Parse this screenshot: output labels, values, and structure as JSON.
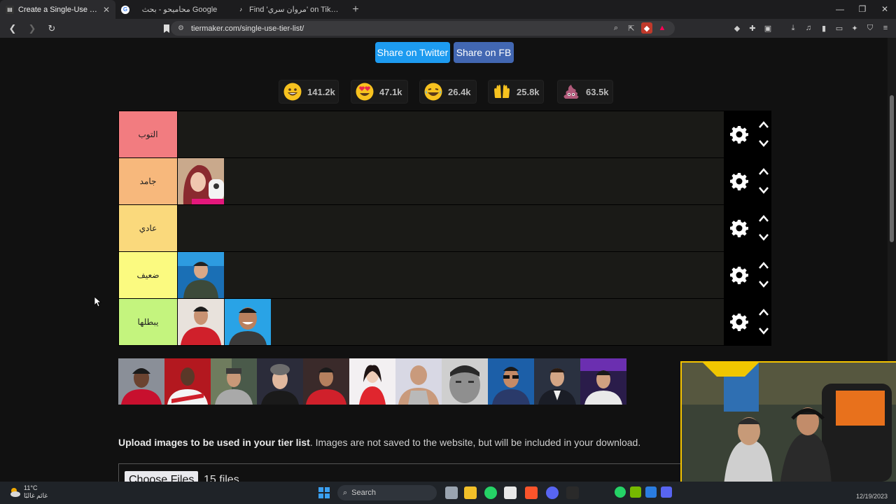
{
  "browser": {
    "tabs": [
      {
        "title": "Create a Single-Use Tier List (Pri",
        "active": true
      },
      {
        "title": "محاميحو - بحث Google",
        "active": false
      },
      {
        "title": "Find 'مروان سري' on TikTok | TikTok Se",
        "active": false
      }
    ],
    "new_tab": "+",
    "url": "tiermaker.com/single-use-tier-list/"
  },
  "share": {
    "twitter_label": "Share on Twitter",
    "fb_label": "Share on FB"
  },
  "reactions": [
    {
      "icon": "grinning-face-icon",
      "count": "141.2k",
      "color": "#f7c21f"
    },
    {
      "icon": "heart-eyes-face-icon",
      "count": "47.1k",
      "color": "#f7c21f"
    },
    {
      "icon": "laughing-tears-face-icon",
      "count": "26.4k",
      "color": "#f7c21f"
    },
    {
      "icon": "raised-hands-icon",
      "count": "25.8k",
      "color": "#f7c21f"
    },
    {
      "icon": "pile-of-poo-icon",
      "count": "63.5k",
      "color": "#b05a7a"
    }
  ],
  "tiers": [
    {
      "label": "التوب",
      "color": "#f27c80",
      "items": []
    },
    {
      "label": "جامد",
      "color": "#f7b87c",
      "items": [
        "woman-in-hijab-photo"
      ]
    },
    {
      "label": "عادي",
      "color": "#fad97c",
      "items": []
    },
    {
      "label": "ضعيف",
      "color": "#fbfa80",
      "items": [
        "man-green-shirt-photo"
      ]
    },
    {
      "label": "يبطلها",
      "color": "#c4f47e",
      "items": [
        "man-red-shirt-photo",
        "smiling-man-blue-photo"
      ]
    }
  ],
  "pool_items": [
    "footballer-liverpool-photo",
    "footballer-zamalek-photo",
    "man-cap-photo",
    "man-grey-curly-hair-photo",
    "footballer-ahly-photo",
    "woman-red-dress-photo",
    "bald-man-tanktop-photo",
    "man-close-up-photo",
    "man-sunglasses-photo",
    "man-suit-photo",
    "gamer-purple-photo"
  ],
  "upload": {
    "text_bold": "Upload images to be used in your tier list",
    "text_rest": ". Images are not saved to the website, but will be included in your download.",
    "choose_label": "Choose Files",
    "file_count": "15 files"
  },
  "taskbar": {
    "temperature": "11°C",
    "weather_text": "غائم غالبًا",
    "search_placeholder": "Search",
    "date": "12/19/2023"
  },
  "colors": {
    "twitter": "#1d9bf0",
    "facebook": "#4267b2",
    "page_bg": "#111111"
  }
}
